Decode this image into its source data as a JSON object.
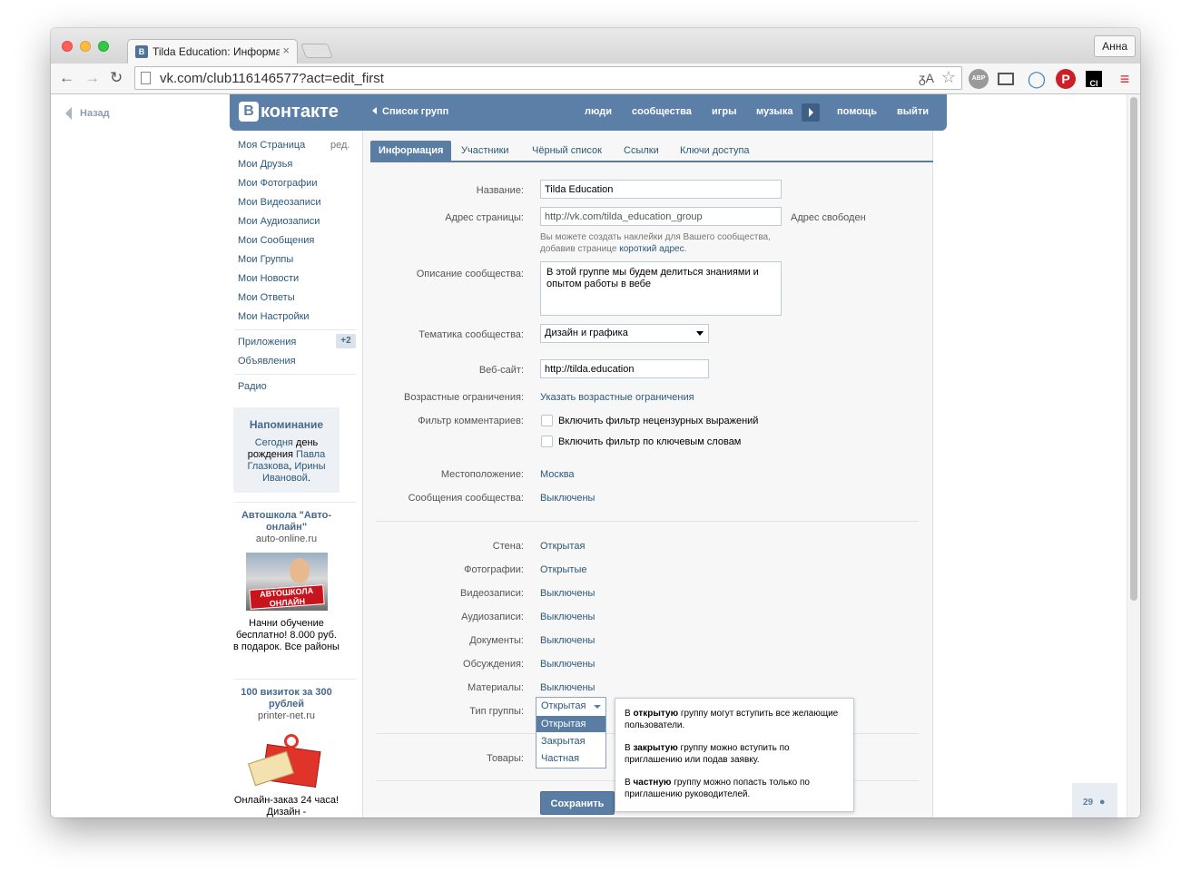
{
  "browser": {
    "tab_title": "Tilda Education: Информа",
    "tab_favicon": "В",
    "tab_close": "×",
    "profile_name": "Анна",
    "url": "vk.com/club116146577?act=edit_first",
    "translate_label": "ᵹA",
    "ext_abp": "ABP",
    "ext_ci": "CI"
  },
  "vk": {
    "back_label": "Назад",
    "logo_letter": "В",
    "logo_text": "контакте",
    "groups_link": "Список групп",
    "nav": [
      "люди",
      "сообщества",
      "игры",
      "музыка",
      "помощь",
      "выйти"
    ]
  },
  "sidebar": {
    "edit_label": "ред.",
    "items": [
      "Моя Страница",
      "Мои Друзья",
      "Мои Фотографии",
      "Мои Видеозаписи",
      "Мои Аудиозаписи",
      "Мои Сообщения",
      "Мои Группы",
      "Мои Новости",
      "Мои Ответы",
      "Мои Настройки"
    ],
    "apps_label": "Приложения",
    "apps_badge": "+2",
    "ads_label": "Объявления",
    "radio_label": "Радио",
    "reminder": {
      "title": "Напоминание",
      "text_1": "Сегодня",
      "text_2": " день рождения ",
      "name_1": "Павла Глазкова",
      "sep": ", ",
      "name_2": "Ирины Ивановой",
      "end": "."
    },
    "ad1": {
      "title": "Автошкола \"Авто-онлайн\"",
      "url": "auto-online.ru",
      "image_text": "АВТОШКОЛА ОНЛАЙН",
      "body": "Начни обучение бесплатно! 8.000 руб. в подарок. Все районы"
    },
    "ad2": {
      "title": "100 визиток за 300 рублей",
      "url": "printer-net.ru",
      "body": "Онлайн-заказ 24 часа! Дизайн -"
    }
  },
  "tabs": [
    "Информация",
    "Участники",
    "Чёрный список",
    "Ссылки",
    "Ключи доступа"
  ],
  "form": {
    "name_label": "Название:",
    "name_value": "Tilda Education",
    "address_label": "Адрес страницы:",
    "address_value": "http://vk.com/tilda_education_group",
    "address_status": "Адрес свободен",
    "address_hint_1": "Вы можете создать наклейки для Вашего сообщества,",
    "address_hint_2": "добавив странице ",
    "address_hint_link": "короткий адрес",
    "address_hint_end": ".",
    "description_label": "Описание сообщества:",
    "description_value": "В этой группе мы будем делиться знаниями и опытом работы в вебе",
    "topic_label": "Тематика сообщества:",
    "topic_value": "Дизайн и графика",
    "website_label": "Веб-сайт:",
    "website_value": "http://tilda.education",
    "age_label": "Возрастные ограничения:",
    "age_value": "Указать возрастные ограничения",
    "filter_label": "Фильтр комментариев:",
    "filter_option_1": "Включить фильтр нецензурных выражений",
    "filter_option_2": "Включить фильтр по ключевым словам",
    "location_label": "Местоположение:",
    "location_value": "Москва",
    "messages_label": "Сообщения сообщества:",
    "messages_value": "Выключены",
    "wall_label": "Стена:",
    "wall_value": "Открытая",
    "photos_label": "Фотографии:",
    "photos_value": "Открытые",
    "videos_label": "Видеозаписи:",
    "videos_value": "Выключены",
    "audio_label": "Аудиозаписи:",
    "audio_value": "Выключены",
    "docs_label": "Документы:",
    "docs_value": "Выключены",
    "discussions_label": "Обсуждения:",
    "discussions_value": "Выключены",
    "materials_label": "Материалы:",
    "materials_value": "Выключены",
    "group_type_label": "Тип группы:",
    "group_type_value": "Открытая",
    "group_type_options": [
      "Открытая",
      "Закрытая",
      "Частная"
    ],
    "goods_label": "Товары:",
    "save_label": "Сохранить"
  },
  "tooltip": {
    "p1_a": "В ",
    "p1_b": "открытую",
    "p1_c": " группу могут вступить все желающие пользователи.",
    "p2_a": "В ",
    "p2_b": "закрытую",
    "p2_c": " группу можно вступить по приглашению или подав заявку.",
    "p3_a": "В ",
    "p3_b": "частную",
    "p3_c": " группу можно попасть только по приглашению руководителей."
  },
  "online_count": "29"
}
